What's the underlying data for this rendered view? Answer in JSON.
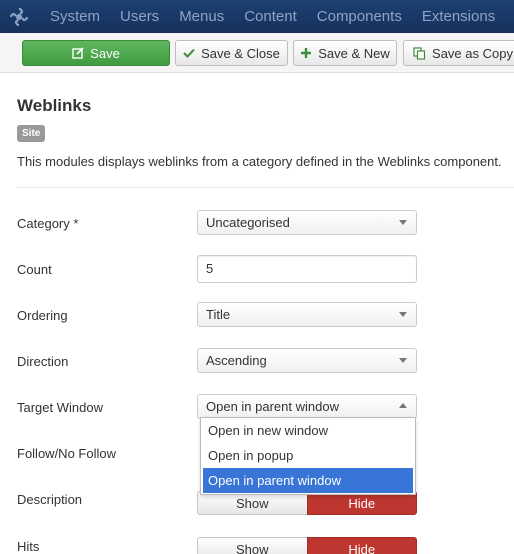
{
  "navbar": {
    "logo_icon": "joomla-logo-icon",
    "items": [
      "System",
      "Users",
      "Menus",
      "Content",
      "Components",
      "Extensions"
    ]
  },
  "toolbar": {
    "save_label": "Save",
    "save_close_label": "Save & Close",
    "save_new_label": "Save & New",
    "save_copy_label": "Save as Copy",
    "save_color": "#4cae4c"
  },
  "module": {
    "title": "Weblinks",
    "badge": "Site",
    "description": "This modules displays weblinks from a category defined in the Weblinks component."
  },
  "fields": {
    "category": {
      "label": "Category *",
      "value": "Uncategorised"
    },
    "count": {
      "label": "Count",
      "value": "5"
    },
    "ordering": {
      "label": "Ordering",
      "value": "Title"
    },
    "direction": {
      "label": "Direction",
      "value": "Ascending"
    },
    "target_window": {
      "label": "Target Window",
      "value": "Open in parent window",
      "options": [
        "Open in new window",
        "Open in popup",
        "Open in parent window"
      ],
      "highlighted": "Open in parent window"
    },
    "follow": {
      "label": "Follow/No Follow"
    },
    "description": {
      "label": "Description",
      "show": "Show",
      "hide": "Hide"
    },
    "hits": {
      "label": "Hits",
      "show": "Show",
      "hide": "Hide"
    }
  },
  "colors": {
    "navbar_bg": "#1a3867",
    "hide_active": "#bd362f",
    "dropdown_highlight": "#3875d7"
  }
}
